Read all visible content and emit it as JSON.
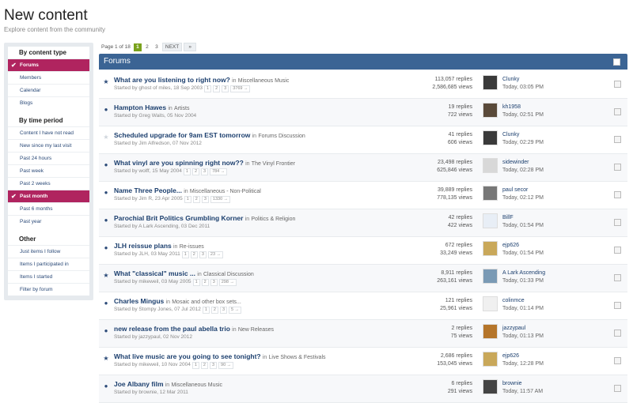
{
  "page": {
    "title": "New content",
    "subtitle": "Explore content from the community"
  },
  "sidebar": {
    "sections": [
      {
        "heading": "By content type",
        "items": [
          {
            "label": "Forums",
            "active": true
          },
          {
            "label": "Members",
            "active": false
          },
          {
            "label": "Calendar",
            "active": false
          },
          {
            "label": "Blogs",
            "active": false
          }
        ]
      },
      {
        "heading": "By time period",
        "items": [
          {
            "label": "Content I have not read",
            "active": false
          },
          {
            "label": "New since my last visit",
            "active": false
          },
          {
            "label": "Past 24 hours",
            "active": false
          },
          {
            "label": "Past week",
            "active": false
          },
          {
            "label": "Past 2 weeks",
            "active": false
          },
          {
            "label": "Past month",
            "active": true
          },
          {
            "label": "Past 6 months",
            "active": false
          },
          {
            "label": "Past year",
            "active": false
          }
        ]
      },
      {
        "heading": "Other",
        "items": [
          {
            "label": "Just items I follow",
            "active": false
          },
          {
            "label": "Items I participated in",
            "active": false
          },
          {
            "label": "Items I started",
            "active": false
          },
          {
            "label": "Filter by forum",
            "active": false
          }
        ]
      }
    ],
    "check_glyph": "✔"
  },
  "pagination": {
    "label": "Page 1 of 18",
    "pages": [
      "1",
      "2",
      "3"
    ],
    "current": "1",
    "next": "NEXT",
    "last": "»"
  },
  "forums": {
    "title": "Forums"
  },
  "in_word": "in",
  "topics": [
    {
      "title": "What are you listening to right now?",
      "forum": "Miscellaneous Music",
      "meta": "Started by ghost of miles, 18 Sep 2003",
      "pages": [
        "1",
        "2",
        "3",
        "3769 →"
      ],
      "replies": "113,057 replies",
      "views": "2,586,685 views",
      "user": "Clunky",
      "date": "Today, 03:05 PM",
      "icon": "★",
      "dim": false,
      "avatar_color": "#3a3a3a"
    },
    {
      "title": "Hampton Hawes",
      "forum": "Artists",
      "meta": "Started by Greg Waits, 05 Nov 2004",
      "pages": [],
      "replies": "19 replies",
      "views": "722 views",
      "user": "kh1958",
      "date": "Today, 02:51 PM",
      "icon": "●",
      "dim": false,
      "avatar_color": "#5a4a3a"
    },
    {
      "title": "Scheduled upgrade for 9am EST tomorrow",
      "forum": "Forums Discussion",
      "meta": "Started by Jim Alfredson, 07 Nov 2012",
      "pages": [],
      "replies": "41 replies",
      "views": "606 views",
      "user": "Clunky",
      "date": "Today, 02:29 PM",
      "icon": "★",
      "dim": true,
      "avatar_color": "#3a3a3a"
    },
    {
      "title": "What vinyl are you spinning right now??",
      "forum": "The Vinyl Frontier",
      "meta": "Started by wolff, 15 May 2004",
      "pages": [
        "1",
        "2",
        "3",
        "784 →"
      ],
      "replies": "23,498 replies",
      "views": "625,846 views",
      "user": "sidewinder",
      "date": "Today, 02:28 PM",
      "icon": "●",
      "dim": false,
      "avatar_color": "#d8d8d8"
    },
    {
      "title": "Name Three People...",
      "forum": "Miscellaneous - Non-Political",
      "meta": "Started by Jim R, 23 Apr 2005",
      "pages": [
        "1",
        "2",
        "3",
        "1330 →"
      ],
      "replies": "39,889 replies",
      "views": "778,135 views",
      "user": "paul secor",
      "date": "Today, 02:12 PM",
      "icon": "●",
      "dim": false,
      "avatar_color": "#777777"
    },
    {
      "title": "Parochial Brit Politics Grumbling Korner",
      "forum": "Politics & Religion",
      "meta": "Started by A Lark Ascending, 03 Dec 2011",
      "pages": [],
      "replies": "42 replies",
      "views": "422 views",
      "user": "BillF",
      "date": "Today, 01:54 PM",
      "icon": "●",
      "dim": false,
      "avatar_color": "#e8eef6"
    },
    {
      "title": "JLH reissue plans",
      "forum": "Re-issues",
      "meta": "Started by JLH, 03 May 2011",
      "pages": [
        "1",
        "2",
        "3",
        "23 →"
      ],
      "replies": "672 replies",
      "views": "33,249 views",
      "user": "ejp626",
      "date": "Today, 01:54 PM",
      "icon": "●",
      "dim": false,
      "avatar_color": "#c9a85a"
    },
    {
      "title": "What \"classical\" music ...",
      "forum": "Classical Discussion",
      "meta": "Started by mikeweil, 03 May 2005",
      "pages": [
        "1",
        "2",
        "3",
        "298 →"
      ],
      "replies": "8,911 replies",
      "views": "263,161 views",
      "user": "A Lark Ascending",
      "date": "Today, 01:33 PM",
      "icon": "★",
      "dim": false,
      "avatar_color": "#7a9ab5"
    },
    {
      "title": "Charles Mingus",
      "forum": "Mosaic and other box sets...",
      "meta": "Started by Stompy Jones, 07 Jul 2012",
      "pages": [
        "1",
        "2",
        "3",
        "5 →"
      ],
      "replies": "121 replies",
      "views": "25,961 views",
      "user": "colinmce",
      "date": "Today, 01:14 PM",
      "icon": "●",
      "dim": false,
      "avatar_color": "#f0f0f0"
    },
    {
      "title": "new release from the paul abella trio",
      "forum": "New Releases",
      "meta": "Started by jazzypaul, 02 Nov 2012",
      "pages": [],
      "replies": "2 replies",
      "views": "75 views",
      "user": "jazzypaul",
      "date": "Today, 01:13 PM",
      "icon": "●",
      "dim": false,
      "avatar_color": "#b5752a"
    },
    {
      "title": "What live music are you going to see tonight?",
      "forum": "Live Shows & Festivals",
      "meta": "Started by mikeweil, 10 Nov 2004",
      "pages": [
        "1",
        "2",
        "3",
        "90 →"
      ],
      "replies": "2,686 replies",
      "views": "153,045 views",
      "user": "ejp626",
      "date": "Today, 12:28 PM",
      "icon": "★",
      "dim": false,
      "avatar_color": "#c9a85a"
    },
    {
      "title": "Joe Albany film",
      "forum": "Miscellaneous Music",
      "meta": "Started by brownie, 12 Mar 2011",
      "pages": [],
      "replies": "6 replies",
      "views": "291 views",
      "user": "brownie",
      "date": "Today, 11:57 AM",
      "icon": "●",
      "dim": false,
      "avatar_color": "#444444"
    }
  ]
}
